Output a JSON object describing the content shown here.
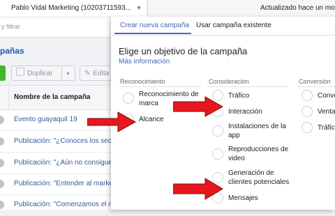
{
  "topbar": {
    "account": "Pablo Vidal Marketing (10203711593...",
    "updated": "Actualizado hace un mom"
  },
  "filterbar": {
    "placeholder": "y filtrar"
  },
  "section": {
    "title": "pañas"
  },
  "toolbar": {
    "duplicate": "Duplicar",
    "edit": "Edita"
  },
  "table": {
    "header": "Nombre de la campaña",
    "rows": [
      "Evento guayaquil 19",
      "Publicación: \"¿Conoces los secr",
      "Publicación: \"¿Aún no consigues",
      "Publicación: \"Entender al marke",
      "Publicación: \"Comenzamos el mes"
    ]
  },
  "modal": {
    "tabs": {
      "new": "Crear nueva campaña",
      "existing": "Usar campaña existente"
    },
    "title": "Elige un objetivo de la campaña",
    "more_info": "Más información",
    "columns": {
      "awareness": {
        "heading": "Reconocimiento",
        "options": [
          "Reconocimiento de marca",
          "Alcance"
        ]
      },
      "consideration": {
        "heading": "Consideración",
        "options": [
          "Tráfico",
          "Interacción",
          "Instalaciones de la app",
          "Reproducciones de video",
          "Generación de clientes potenciales",
          "Mensajes"
        ]
      },
      "conversion": {
        "heading": "Conversión",
        "options": [
          "Conve",
          "Venta",
          "Tráfico"
        ]
      }
    }
  },
  "annotation_color": "#e8171d",
  "accent_color": "#4267b2"
}
